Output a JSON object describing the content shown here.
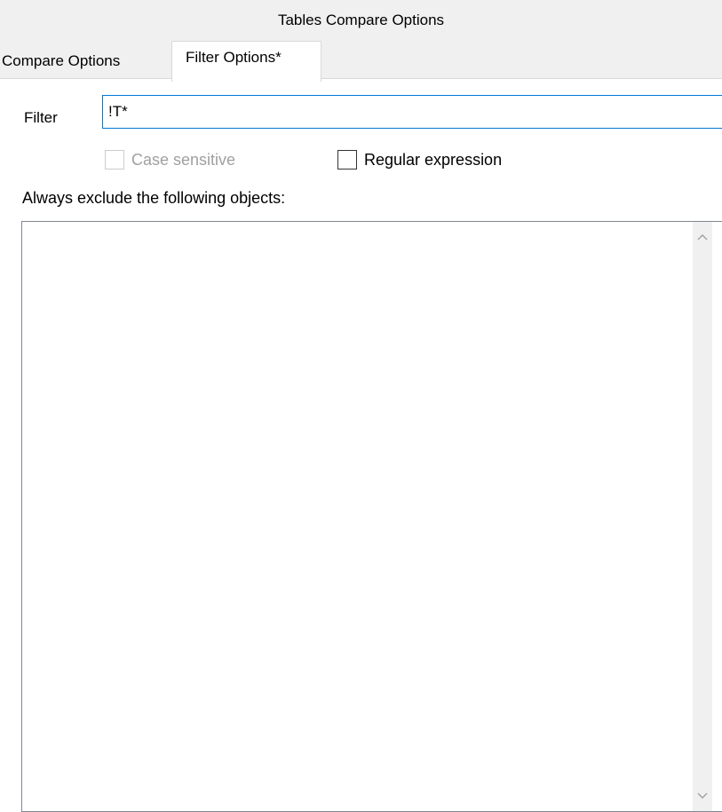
{
  "window": {
    "title": "Tables Compare Options"
  },
  "tabs": [
    {
      "label": "Compare Options",
      "active": false
    },
    {
      "label": "Filter Options*",
      "active": true
    }
  ],
  "filter": {
    "label": "Filter",
    "value": "!T*"
  },
  "options": {
    "case_sensitive": {
      "label": "Case sensitive",
      "checked": false,
      "enabled": false
    },
    "regular_expression": {
      "label": "Regular expression",
      "checked": false,
      "enabled": true
    }
  },
  "exclude": {
    "label": "Always exclude the following objects:",
    "items": []
  },
  "icons": {
    "scroll_up": "chevron-up-icon",
    "scroll_down": "chevron-down-icon"
  },
  "colors": {
    "focus_border": "#0078d7",
    "disabled_text": "#a0a0a0",
    "dialog_background": "#f0f0f0"
  }
}
